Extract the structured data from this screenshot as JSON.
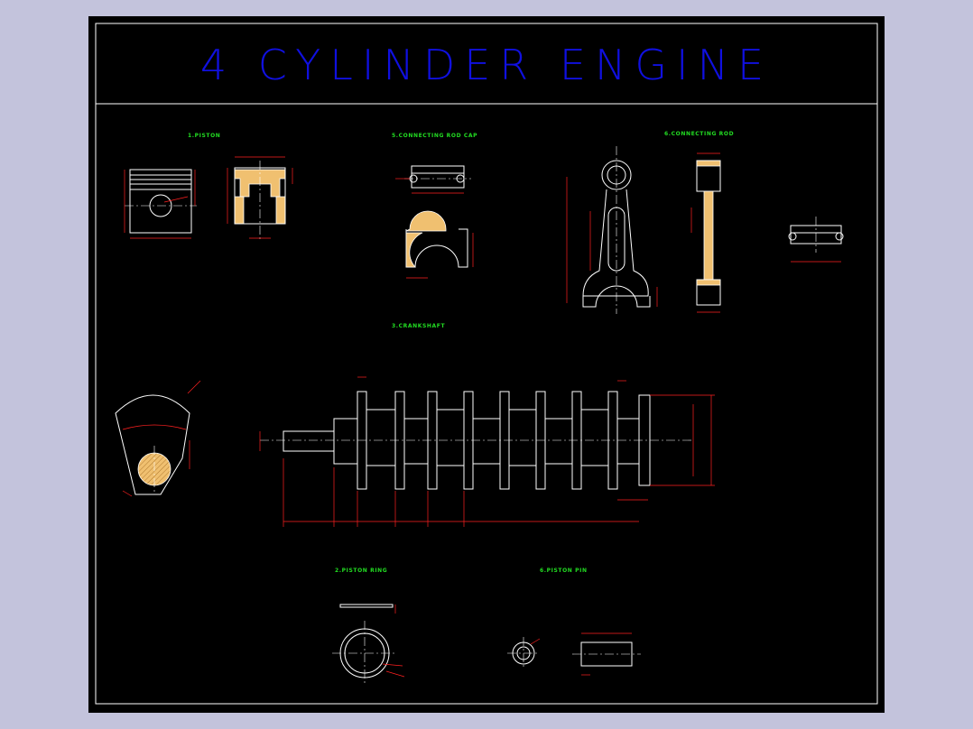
{
  "title": "4 CYLINDER ENGINE",
  "parts": {
    "piston": "1.PISTON",
    "connecting_rod_cap": "5.CONNECTING ROD CAP",
    "connecting_rod": "6.CONNECTING ROD",
    "crankshaft": "3.CRANKSHAFT",
    "piston_ring": "2.PISTON RING",
    "piston_pin": "6.PISTON PIN"
  },
  "colors": {
    "background": "#000000",
    "frame": "#ffffff",
    "title": "#1010e0",
    "labels": "#22dd22",
    "dimensions": "#ff2020",
    "section_fill": "#f0c070"
  }
}
